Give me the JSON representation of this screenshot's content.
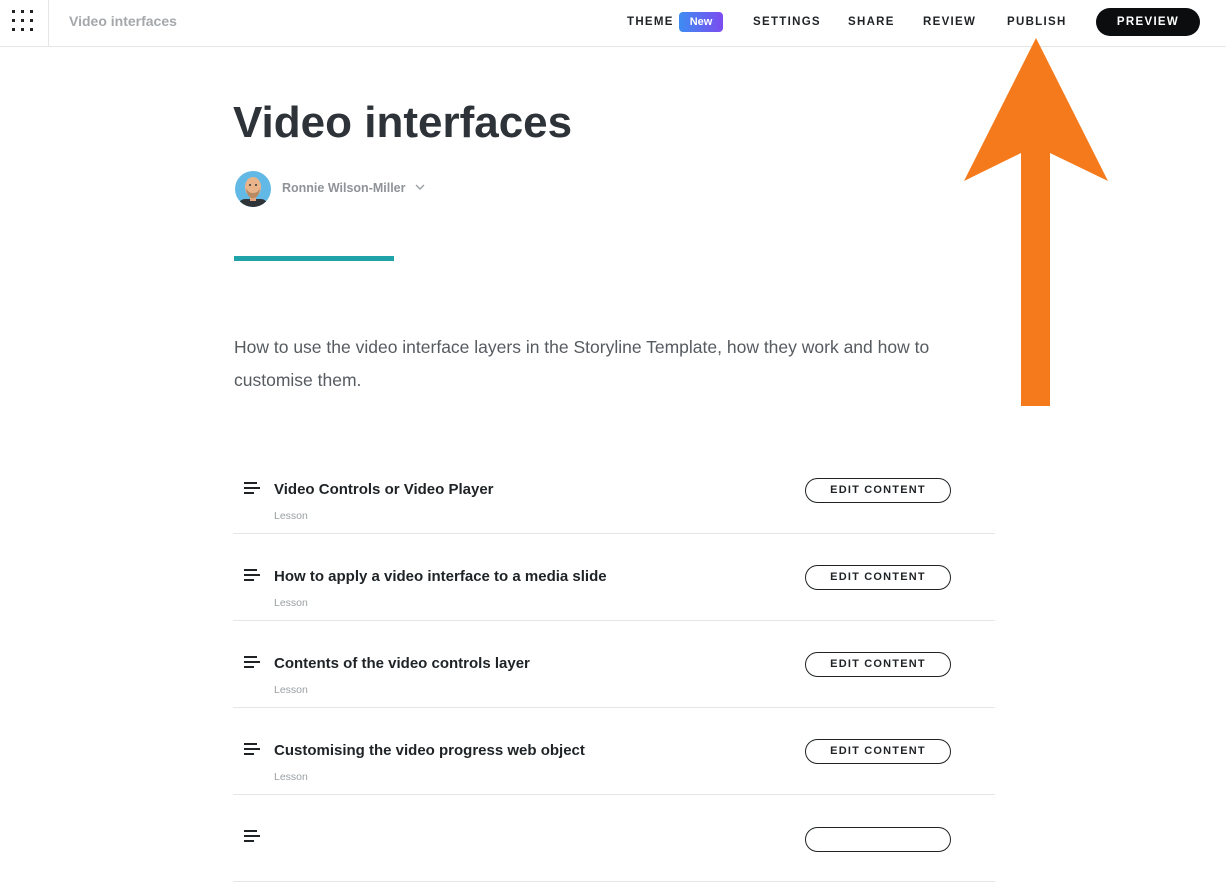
{
  "header": {
    "course_title": "Video interfaces",
    "nav": {
      "theme": "THEME",
      "theme_badge": "New",
      "settings": "SETTINGS",
      "share": "SHARE",
      "review": "REVIEW",
      "publish": "PUBLISH",
      "preview": "PREVIEW"
    }
  },
  "course": {
    "title": "Video interfaces",
    "author": "Ronnie Wilson-Miller",
    "description": "How to use the video interface layers in the Storyline Template, how they work and how to customise them."
  },
  "lessons": [
    {
      "title": "Video Controls or Video Player",
      "type": "Lesson",
      "action": "EDIT CONTENT"
    },
    {
      "title": "How to apply a video interface to a media slide",
      "type": "Lesson",
      "action": "EDIT CONTENT"
    },
    {
      "title": "Contents of the video controls layer",
      "type": "Lesson",
      "action": "EDIT CONTENT"
    },
    {
      "title": "Customising the video progress web object",
      "type": "Lesson",
      "action": "EDIT CONTENT"
    }
  ],
  "colors": {
    "accent": "#1fa2a8",
    "badge_gradient_start": "#3d8cf2",
    "badge_gradient_end": "#7c4cf0",
    "annotation_arrow": "#f57a1b"
  },
  "icons": {
    "menu": "grid-menu-icon",
    "author_menu": "chevron-down-icon",
    "lesson": "text-lines-icon",
    "annotation": "arrow-up-icon"
  }
}
